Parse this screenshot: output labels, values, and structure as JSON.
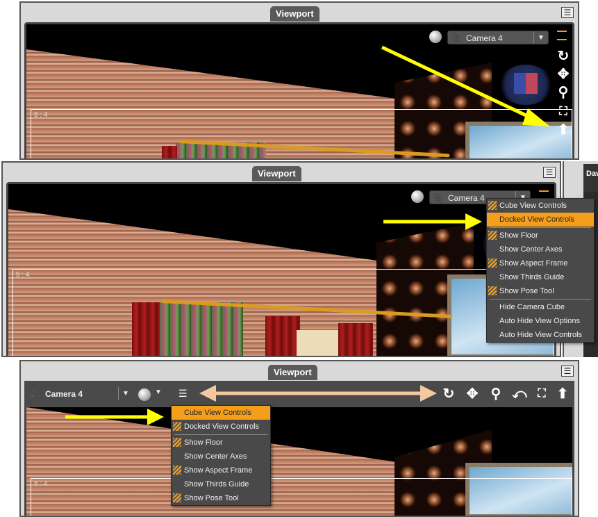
{
  "panels": [
    {
      "tab": "Viewport",
      "camera": "Camera 4",
      "aspect_label": "5 : 4"
    },
    {
      "tab": "Viewport",
      "camera": "Camera 4",
      "aspect_label": "5 : 4",
      "side_tab": "Dav"
    },
    {
      "tab": "Viewport",
      "camera": "Camera 4",
      "aspect_label": "5 : 4"
    }
  ],
  "menu_middle": [
    {
      "label": "Cube View Controls",
      "checked": true,
      "highlight": false
    },
    {
      "label": "Docked View Controls",
      "checked": false,
      "highlight": true
    },
    {
      "sep": true
    },
    {
      "label": "Show Floor",
      "checked": true,
      "highlight": false
    },
    {
      "label": "Show Center Axes",
      "checked": false,
      "highlight": false
    },
    {
      "label": "Show Aspect Frame",
      "checked": true,
      "highlight": false
    },
    {
      "label": "Show Thirds Guide",
      "checked": false,
      "highlight": false
    },
    {
      "label": "Show Pose Tool",
      "checked": true,
      "highlight": false
    },
    {
      "sep": true
    },
    {
      "label": "Hide Camera Cube",
      "checked": false,
      "highlight": false
    },
    {
      "label": "Auto Hide View Options",
      "checked": false,
      "highlight": false
    },
    {
      "label": "Auto Hide View Controls",
      "checked": false,
      "highlight": false
    }
  ],
  "menu_bottom": [
    {
      "label": "Cube View Controls",
      "checked": false,
      "highlight": true
    },
    {
      "label": "Docked View Controls",
      "checked": true,
      "highlight": false
    },
    {
      "sep": true
    },
    {
      "label": "Show Floor",
      "checked": true,
      "highlight": false
    },
    {
      "label": "Show Center Axes",
      "checked": false,
      "highlight": false
    },
    {
      "label": "Show Aspect Frame",
      "checked": true,
      "highlight": false
    },
    {
      "label": "Show Thirds Guide",
      "checked": false,
      "highlight": false
    },
    {
      "label": "Show Pose Tool",
      "checked": true,
      "highlight": false
    }
  ],
  "controls": [
    {
      "icon": "orbit-icon",
      "glyph": "↻"
    },
    {
      "icon": "pan-icon",
      "glyph": "✥"
    },
    {
      "icon": "zoom-icon",
      "glyph": "⚲"
    },
    {
      "icon": "roll-icon",
      "glyph": "⤺"
    },
    {
      "icon": "frame-icon",
      "glyph": "⛶"
    },
    {
      "icon": "home-icon",
      "glyph": "⬆"
    }
  ],
  "colors": {
    "highlight": "#f59e1b",
    "annotation_arrow": "#ffff00",
    "double_arrow": "#f5c8a0"
  }
}
